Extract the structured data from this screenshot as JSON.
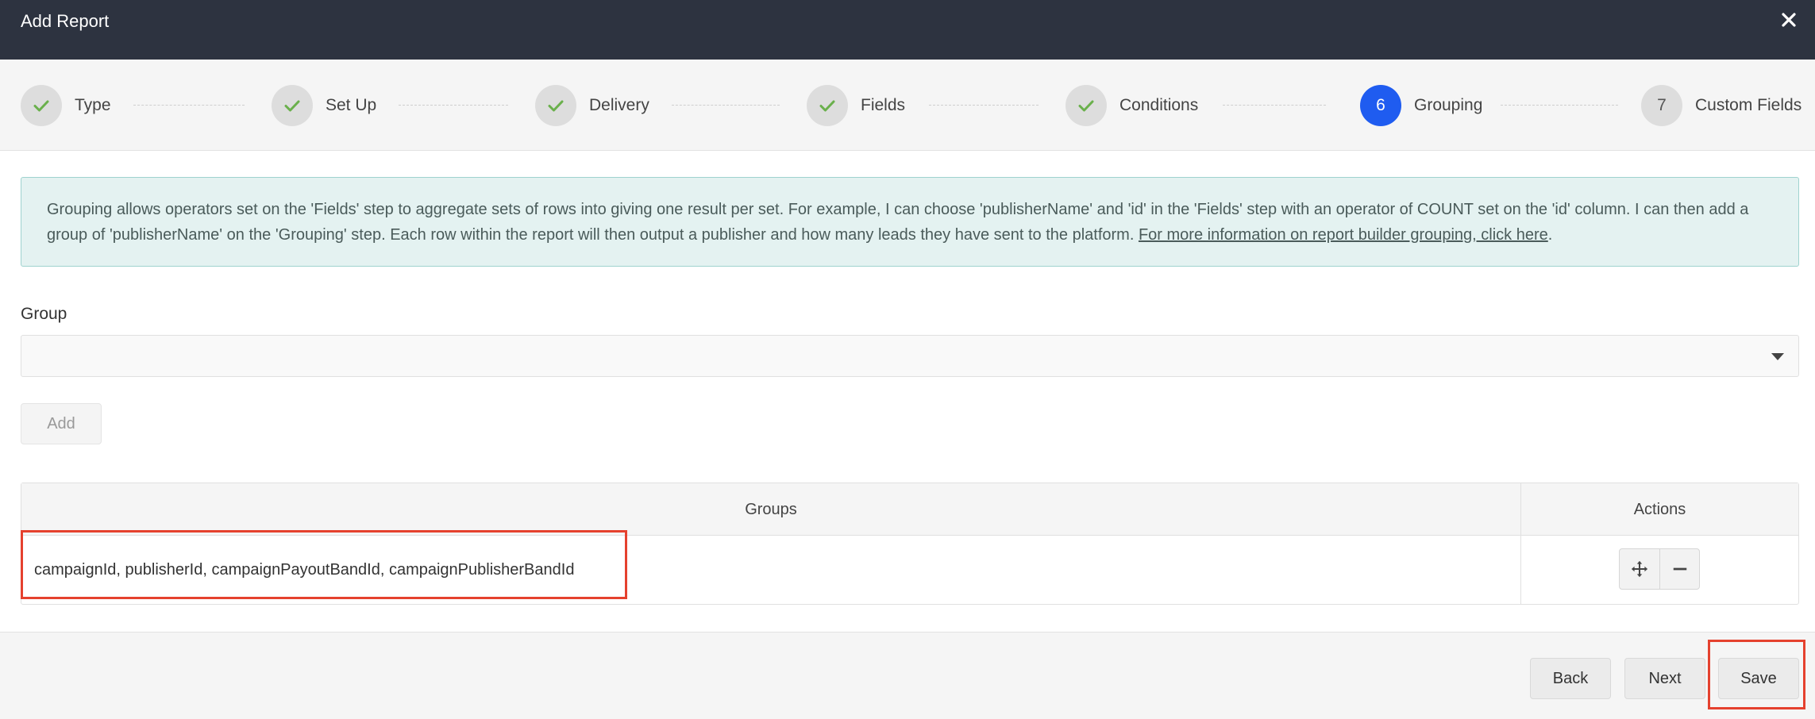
{
  "window": {
    "title": "Add Report",
    "close_icon": "close-icon"
  },
  "steps": [
    {
      "number": "1",
      "label": "Type",
      "status": "complete"
    },
    {
      "number": "2",
      "label": "Set Up",
      "status": "complete"
    },
    {
      "number": "3",
      "label": "Delivery",
      "status": "complete"
    },
    {
      "number": "4",
      "label": "Fields",
      "status": "complete"
    },
    {
      "number": "5",
      "label": "Conditions",
      "status": "complete"
    },
    {
      "number": "6",
      "label": "Grouping",
      "status": "active"
    },
    {
      "number": "7",
      "label": "Custom Fields",
      "status": "pending"
    }
  ],
  "info": {
    "text": "Grouping allows operators set on the 'Fields' step to aggregate sets of rows into giving one result per set. For example, I can choose 'publisherName' and 'id' in the 'Fields' step with an operator of COUNT set on the 'id' column. I can then add a group of 'publisherName' on the 'Grouping' step. Each row within the report will then output a publisher and how many leads they have sent to the platform. ",
    "link_text": "For more information on report builder grouping, click here",
    "trailing": "."
  },
  "group_field": {
    "label": "Group",
    "value": ""
  },
  "add_button": {
    "label": "Add",
    "enabled": false
  },
  "table": {
    "headers": {
      "groups": "Groups",
      "actions": "Actions"
    },
    "rows": [
      {
        "groups": "campaignId, publisherId, campaignPayoutBandId, campaignPublisherBandId"
      }
    ]
  },
  "footer": {
    "back_label": "Back",
    "next_label": "Next",
    "save_label": "Save"
  },
  "colors": {
    "titlebar": "#2d3340",
    "active_step": "#1f5cf0",
    "check": "#6ab04c",
    "highlight": "#e5412e",
    "info_bg": "#e4f2f1"
  }
}
